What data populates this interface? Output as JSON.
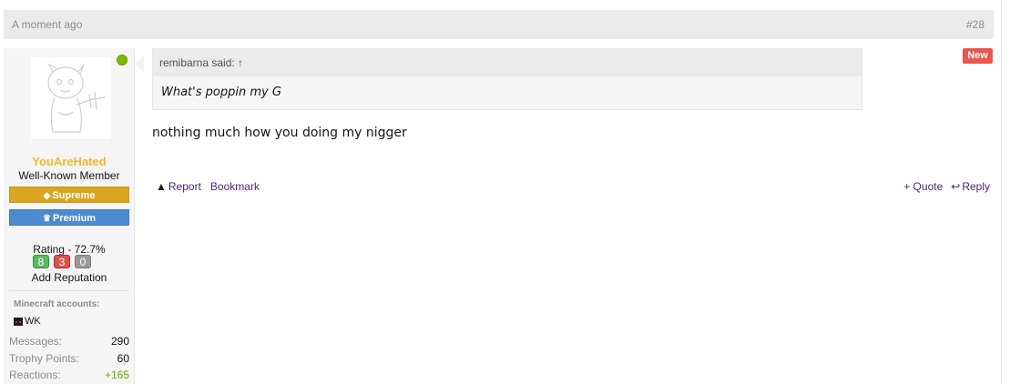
{
  "post": {
    "time": "A moment ago",
    "number": "#28",
    "new_badge": "New"
  },
  "user": {
    "name": "YouAreHated",
    "title": "Well-Known Member",
    "ranks": [
      "Supreme",
      "Premium"
    ],
    "rating": "Rating - 72.7%",
    "reputation": [
      "8",
      "3",
      "0"
    ],
    "add_reputation": "Add Reputation",
    "minecraft_title": "Minecraft accounts:",
    "minecraft_account": "WK",
    "stats": [
      {
        "label": "Messages:",
        "value": "290"
      },
      {
        "label": "Trophy Points:",
        "value": "60"
      },
      {
        "label": "Reactions:",
        "value": "+165"
      }
    ]
  },
  "quote": {
    "author": "remibarna said: ↑",
    "text": "What's poppin my G"
  },
  "message": "nothing much how you doing my nigger",
  "actions": {
    "report": "Report",
    "bookmark": "Bookmark",
    "quote": "+ Quote",
    "reply": "Reply"
  },
  "icons": {
    "supreme": "diamond-icon",
    "premium": "trophy-icon",
    "report": "warning-icon",
    "reply": "reply-icon"
  },
  "colors": {
    "username": "#f2b632",
    "supreme": "#d9a521",
    "premium": "#4d8ad2",
    "new": "#e9564f",
    "link": "#47287a",
    "online": "#7fb900"
  }
}
